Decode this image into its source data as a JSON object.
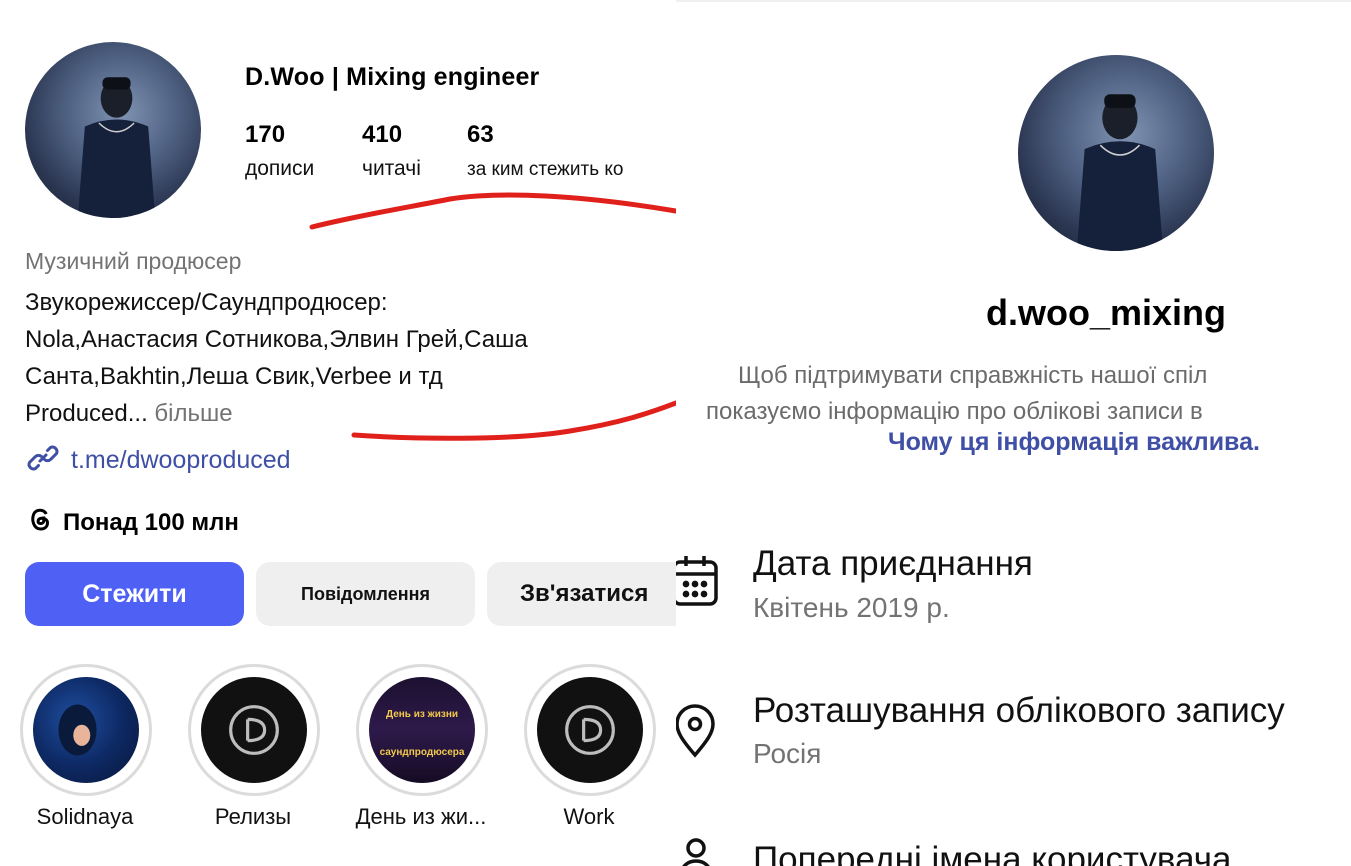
{
  "left_profile": {
    "username": "D.Woo | Mixing engineer",
    "stats": [
      {
        "value": "170",
        "label": "дописи"
      },
      {
        "value": "410",
        "label": "читачі"
      },
      {
        "value": "63",
        "label": "за ким стежить ко"
      }
    ],
    "category": "Музичний продюсер",
    "bio_lines": [
      "Звукорежиссер/Саундпродюсер:",
      "Nola,Анастасия Сотникова,Элвин Грей,Саша",
      "Санта,Bakhtin,Леша Свик,Verbee и тд",
      "Produced..."
    ],
    "bio_more": "більше",
    "link": "t.me/dwooproduced",
    "threads": "Понад 100 млн",
    "buttons": {
      "follow": "Стежити",
      "message": "Повідомлення",
      "contact": "Зв'язатися"
    },
    "highlights": [
      {
        "label": "Solidnaya"
      },
      {
        "label": "Релизы"
      },
      {
        "label": "День из жи...",
        "cover_top": "День из жизни",
        "cover_bottom": "саундпродюсера"
      },
      {
        "label": "Work"
      }
    ]
  },
  "right_profile": {
    "username": "d.woo_mixing",
    "description_line1": "Щоб підтримувати справжність нашої спіл",
    "description_line2": "показуємо інформацію про облікові записи в",
    "why_link": "Чому ця інформація важлива.",
    "items": [
      {
        "title": "Дата приєднання",
        "value": "Квітень 2019 р.",
        "icon": "calendar-icon"
      },
      {
        "title": "Розташування облікового запису",
        "value": "Росія",
        "icon": "location-pin-icon"
      },
      {
        "title": "Попередні імена користувача",
        "icon": "user-icon"
      }
    ]
  },
  "colors": {
    "accent": "#4f61f5",
    "link": "#3f4fa6",
    "annotation": "#e0201b"
  }
}
